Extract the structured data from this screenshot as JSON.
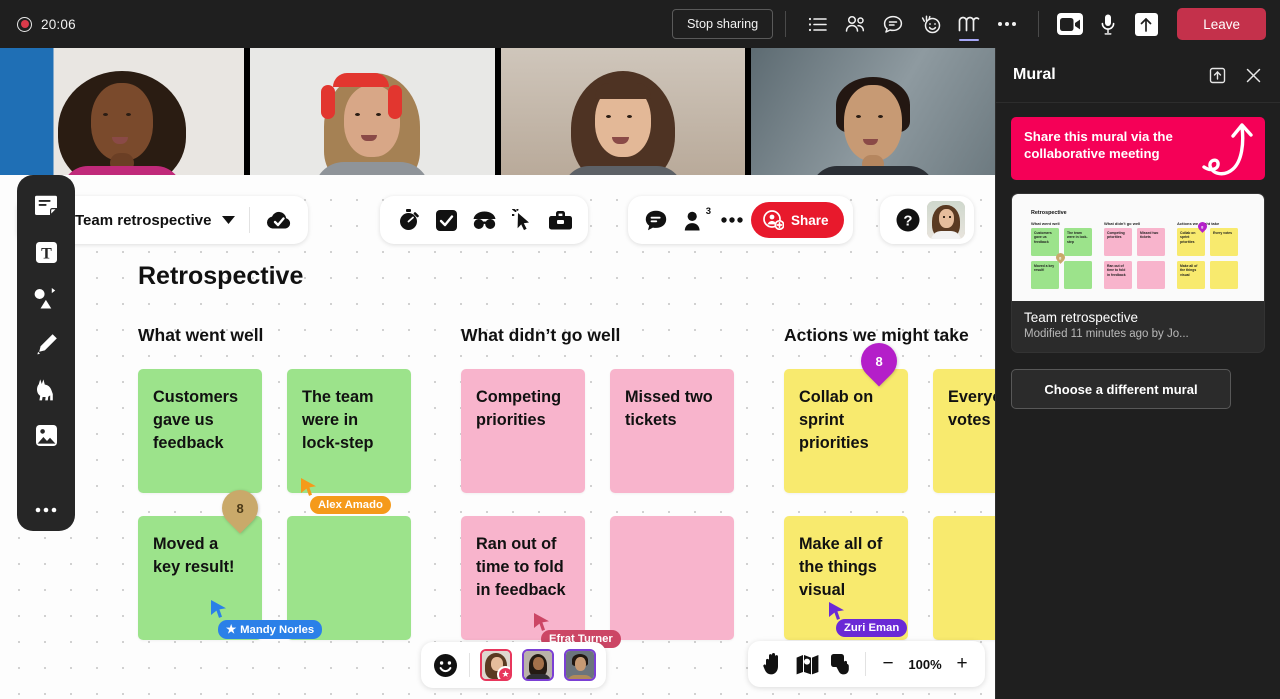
{
  "meeting": {
    "recording_time": "20:06",
    "stop_sharing_label": "Stop sharing",
    "leave_label": "Leave",
    "icons": [
      {
        "name": "agenda-list-icon",
        "glyph": "list"
      },
      {
        "name": "people-icon",
        "glyph": "people"
      },
      {
        "name": "chat-icon",
        "glyph": "chat"
      },
      {
        "name": "reactions-icon",
        "glyph": "reaction"
      },
      {
        "name": "mural-app-icon",
        "glyph": "mural",
        "active": true
      },
      {
        "name": "more-options-icon",
        "glyph": "dots"
      },
      {
        "name": "camera-icon",
        "glyph": "camera"
      },
      {
        "name": "microphone-icon",
        "glyph": "mic"
      },
      {
        "name": "share-screen-icon",
        "glyph": "share-up"
      }
    ]
  },
  "video_tiles": [
    {
      "name": "participant-tile-1"
    },
    {
      "name": "participant-tile-2"
    },
    {
      "name": "participant-tile-3"
    },
    {
      "name": "participant-tile-4"
    }
  ],
  "mural_panel": {
    "title": "Mural",
    "popout_icon": "popout-icon",
    "close_icon": "close-icon",
    "promo": "Share this mural via the collaborative meeting",
    "promo_color": "#f50057",
    "card": {
      "title": "Team retrospective",
      "subtitle": "Modified 11 minutes ago by Jo...",
      "thumb_title": "Retrospective",
      "thumb_columns": [
        "What went well",
        "What didn't go well",
        "Actions we might take"
      ],
      "thumb_notes": [
        "Customers gave us feedback",
        "The team were in lock-step",
        "Competing priorities",
        "Missed two tickets",
        "Collab on sprint priorities",
        "Every votes",
        "Moved a key result!",
        "",
        "Ran out of time to fold in feedback",
        "",
        "Make all of the things visual",
        ""
      ]
    },
    "choose_button": "Choose a different mural"
  },
  "mural_header": {
    "board_name": "Team retrospective",
    "chevron_icon": "chevron-down-icon",
    "saved_icon": "cloud-saved-icon",
    "tools": [
      {
        "name": "timer-icon"
      },
      {
        "name": "checkbox-icon"
      },
      {
        "name": "private-mode-icon"
      },
      {
        "name": "follow-cursor-icon"
      },
      {
        "name": "toolkit-icon"
      }
    ],
    "chat_icon": "comment-icon",
    "members_icon": "members-icon",
    "members_count": "3",
    "more_icon": "more-dots-icon",
    "share_label": "Share",
    "share_color": "#e8192c",
    "help_icon": "help-icon",
    "avatar": "user-avatar"
  },
  "left_rail": [
    {
      "name": "sticky-note-tool"
    },
    {
      "name": "text-tool"
    },
    {
      "name": "shapes-connector-tool"
    },
    {
      "name": "pen-tool"
    },
    {
      "name": "llama-icons-tool"
    },
    {
      "name": "image-tool"
    },
    {
      "name": "more-tools"
    }
  ],
  "board": {
    "title": "Retrospective",
    "columns": [
      {
        "title": "What went well",
        "color": "#9ce38b",
        "notes": [
          {
            "text": "Customers gave us feedback"
          },
          {
            "text": "The team were in lock-step"
          },
          {
            "text": "Moved a key result!"
          },
          {
            "text": ""
          }
        ]
      },
      {
        "title": "What didn’t go well",
        "color": "#f8b4cc",
        "notes": [
          {
            "text": "Competing priorities"
          },
          {
            "text": "Missed two tickets"
          },
          {
            "text": "Ran out of time to fold in feedback"
          },
          {
            "text": ""
          }
        ]
      },
      {
        "title": "Actions we might take",
        "color": "#f8ea6e",
        "notes": [
          {
            "text": "Collab on sprint priorities"
          },
          {
            "text": "Everyo votes"
          },
          {
            "text": "Make all of the things visual"
          },
          {
            "text": ""
          }
        ]
      }
    ],
    "vote_pins": [
      {
        "name": "vote-pin-gold",
        "count": "8",
        "color": "#c9a96a"
      },
      {
        "name": "vote-pin-purple",
        "count": "8",
        "color": "#b41fc9"
      }
    ],
    "cursors": [
      {
        "name": "Alex Amado",
        "color": "#f59a1a",
        "starred": false
      },
      {
        "name": "Efrat Turner",
        "color": "#cc4665",
        "starred": false
      },
      {
        "name": "Zuri Eman",
        "color": "#6a29d6",
        "starred": false
      },
      {
        "name": "Mandy Norles",
        "color": "#2b80e8",
        "starred": true
      }
    ]
  },
  "bottom": {
    "reaction_icon": "smiley-icon",
    "participants": [
      {
        "name": "collaborator-avatar-1",
        "border": "#e8365c",
        "starred": true
      },
      {
        "name": "collaborator-avatar-2",
        "border": "#7b3fd4",
        "starred": false
      },
      {
        "name": "collaborator-avatar-3",
        "border": "#7b3fd4",
        "starred": false
      }
    ],
    "zoom_tools": [
      {
        "name": "hand-pan-tool"
      },
      {
        "name": "map-outline-tool"
      },
      {
        "name": "pointer-hand-tool"
      }
    ],
    "zoom_out_label": "−",
    "zoom_level": "100%",
    "zoom_in_label": "+"
  }
}
